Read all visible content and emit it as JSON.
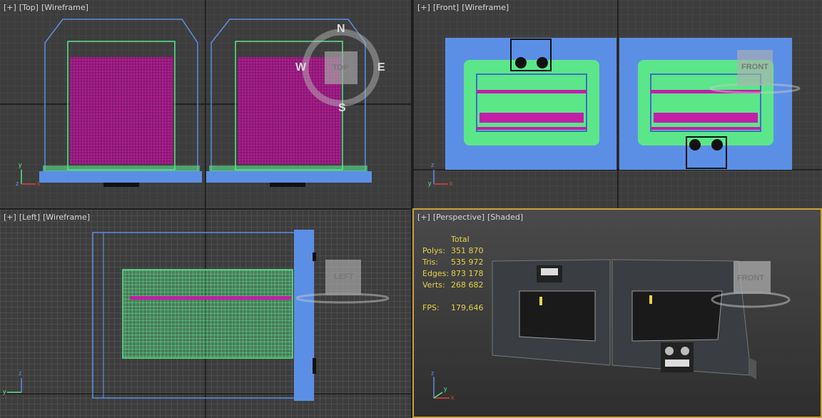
{
  "viewports": {
    "top": {
      "plus": "[+]",
      "view": "[Top]",
      "mode": "[Wireframe]"
    },
    "front": {
      "plus": "[+]",
      "view": "[Front]",
      "mode": "[Wireframe]"
    },
    "left": {
      "plus": "[+]",
      "view": "[Left]",
      "mode": "[Wireframe]"
    },
    "perspective": {
      "plus": "[+]",
      "view": "[Perspective]",
      "mode": "[Shaded]"
    }
  },
  "viewcube": {
    "top": "TOP",
    "front": "FRONT",
    "left": "LEFT",
    "compass": {
      "n": "N",
      "s": "S",
      "e": "E",
      "w": "W"
    }
  },
  "axes": {
    "x": "x",
    "y": "y",
    "z": "z"
  },
  "stats": {
    "header": "Total",
    "rows": [
      {
        "label": "Polys:",
        "value": "351 870"
      },
      {
        "label": "Tris:",
        "value": "535 972"
      },
      {
        "label": "Edges:",
        "value": "873 178"
      },
      {
        "label": "Verts:",
        "value": "268 682"
      }
    ],
    "fps_label": "FPS:",
    "fps_value": "179,646"
  },
  "colors": {
    "viewport_bg": "#3d3d3d",
    "grid": "#555555",
    "grid_major": "#1a1a1a",
    "wire_blue": "#5b8fe6",
    "wire_green": "#5be68a",
    "wire_magenta": "#c21ea8",
    "stats_text": "#e3d24a",
    "active_border": "#c8a23c"
  }
}
